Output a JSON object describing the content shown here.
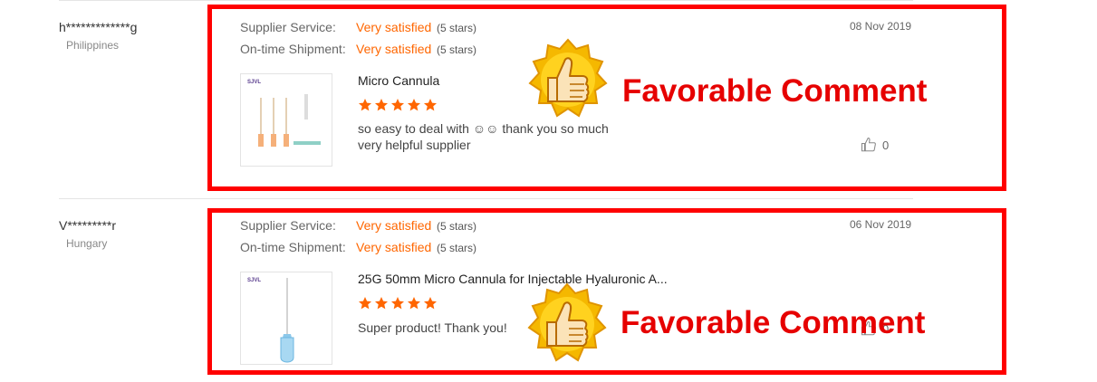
{
  "reviews": [
    {
      "reviewer": "h*************g",
      "country": "Philippines",
      "service_label": "Supplier Service:",
      "service_value": "Very satisfied",
      "service_stars": "(5 stars)",
      "shipment_label": "On-time Shipment:",
      "shipment_value": "Very satisfied",
      "shipment_stars": "(5 stars)",
      "date": "08 Nov 2019",
      "product_name": "Micro Cannula",
      "product_brand": "SJVL",
      "rating": 5,
      "comment": "so easy to deal with ☺☺ thank you so much very helpful supplier",
      "likes": "0",
      "badge": "Favorable Comment"
    },
    {
      "reviewer": "V*********r",
      "country": "Hungary",
      "service_label": "Supplier Service:",
      "service_value": "Very satisfied",
      "service_stars": "(5 stars)",
      "shipment_label": "On-time Shipment:",
      "shipment_value": "Very satisfied",
      "shipment_stars": "(5 stars)",
      "date": "06 Nov 2019",
      "product_name": "25G 50mm Micro Cannula for Injectable Hyaluronic A...",
      "product_brand": "SJVL",
      "rating": 5,
      "comment": "Super product! Thank you!",
      "likes": "0",
      "badge": "Favorable Comment"
    }
  ],
  "colors": {
    "accent": "#ff6600",
    "highlight_border": "#ff0000",
    "badge_text": "#e60000",
    "star": "#ff6600"
  },
  "icons": [
    "thumbs-up-badge-icon",
    "star-icon",
    "like-icon"
  ]
}
